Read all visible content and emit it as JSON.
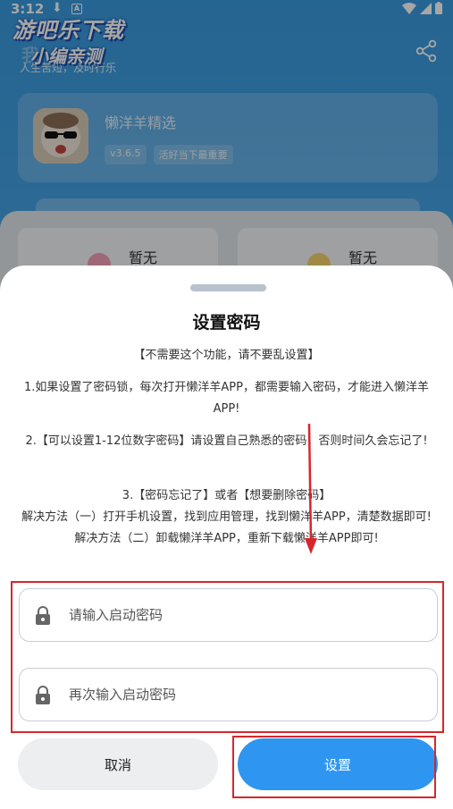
{
  "status_bar": {
    "time": "3:12",
    "download_glyph": "⬇",
    "notif_letter": "A"
  },
  "watermark": {
    "line1": "游吧乐下载",
    "line2": "小编亲测"
  },
  "background": {
    "title": "我",
    "subtitle": "人生苦短，及时行乐",
    "app_name": "懒洋羊精选",
    "version_tag": "v3.6.5",
    "slogan_tag": "活好当下最重要",
    "tile_left_label": "暂无",
    "tile_right_label": "暂无"
  },
  "dialog": {
    "title": "设置密码",
    "note": "【不需要这个功能，请不要乱设置】",
    "paragraph1": "1.如果设置了密码锁，每次打开懒洋羊APP，都需要输入密码，才能进入懒洋羊APP!",
    "paragraph2": "2.【可以设置1-12位数字密码】请设置自己熟悉的密码，否则时间久会忘记了!",
    "paragraph3_line1": "3.【密码忘记了】或者【想要删除密码】",
    "paragraph3_line2": "解决方法（一）打开手机设置，找到应用管理，找到懒洋羊APP，清楚数据即可!",
    "paragraph3_line3": "解决方法（二）卸载懒洋羊APP，重新下载懒洋羊APP即可!",
    "password_placeholder": "请输入启动密码",
    "confirm_placeholder": "再次输入启动密码",
    "password_value": "",
    "confirm_value": "",
    "cancel_label": "取消",
    "set_label": "设置"
  },
  "colors": {
    "primary_blue": "#2e96f0",
    "annotation_red": "#d8262b",
    "header_blue": "#3a9be0"
  },
  "icons": [
    "download-icon",
    "wifi-icon",
    "signal-icon",
    "battery-icon",
    "share-icon",
    "lock-icon",
    "annotation-arrow"
  ]
}
